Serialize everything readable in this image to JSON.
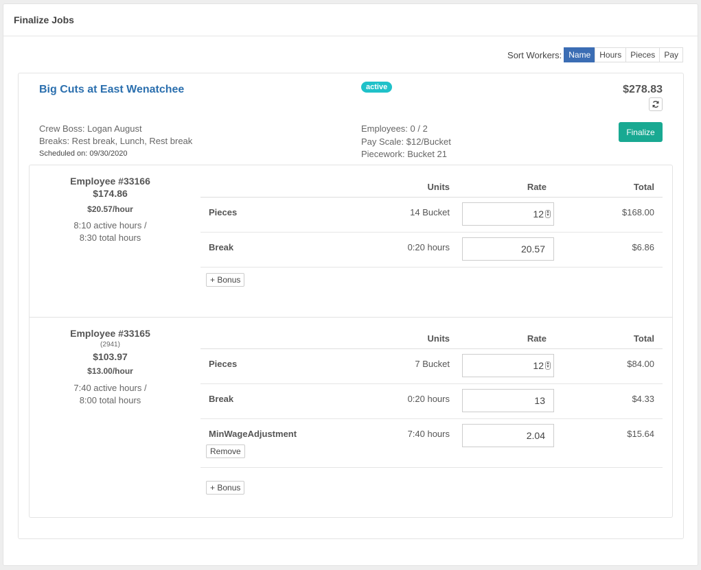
{
  "header": {
    "title": "Finalize Jobs"
  },
  "sort": {
    "label": "Sort Workers:",
    "options": [
      "Name",
      "Hours",
      "Pieces",
      "Pay"
    ],
    "active": "Name"
  },
  "job": {
    "title": "Big Cuts at East Wenatchee",
    "status": "active",
    "total": "$278.83",
    "crew_boss": "Crew Boss: Logan August",
    "breaks": "Breaks: Rest break, Lunch, Rest break",
    "scheduled": "Scheduled on: 09/30/2020",
    "employees": "Employees: 0 / 2",
    "pay_scale": "Pay Scale: $12/Bucket",
    "piecework": "Piecework: Bucket 21",
    "finalize_label": "Finalize"
  },
  "table_headers": {
    "units": "Units",
    "rate": "Rate",
    "total": "Total"
  },
  "employees": [
    {
      "name": "Employee #33166",
      "sub": "",
      "total": "$174.86",
      "rate": "$20.57/hour",
      "active_hours": "8:10 active hours /",
      "total_hours": "8:30 total hours",
      "rows": [
        {
          "label": "Pieces",
          "units": "14 Bucket",
          "rate": "12",
          "total": "$168.00"
        },
        {
          "label": "Break",
          "units": "0:20 hours",
          "rate": "20.57",
          "total": "$6.86"
        }
      ],
      "bonus_label": "+ Bonus"
    },
    {
      "name": "Employee #33165",
      "sub": "(2941)",
      "total": "$103.97",
      "rate": "$13.00/hour",
      "active_hours": "7:40 active hours /",
      "total_hours": "8:00 total hours",
      "rows": [
        {
          "label": "Pieces",
          "units": "7 Bucket",
          "rate": "12",
          "total": "$84.00"
        },
        {
          "label": "Break",
          "units": "0:20 hours",
          "rate": "13",
          "total": "$4.33"
        },
        {
          "label": "MinWageAdjustment",
          "units": "7:40 hours",
          "rate": "2.04",
          "total": "$15.64",
          "remove_label": "Remove"
        }
      ],
      "bonus_label": "+ Bonus"
    }
  ],
  "colors": {
    "primary": "#3b6db4",
    "finalize": "#19a992",
    "badge": "#1fc1c9",
    "title_link": "#2b6fae"
  }
}
